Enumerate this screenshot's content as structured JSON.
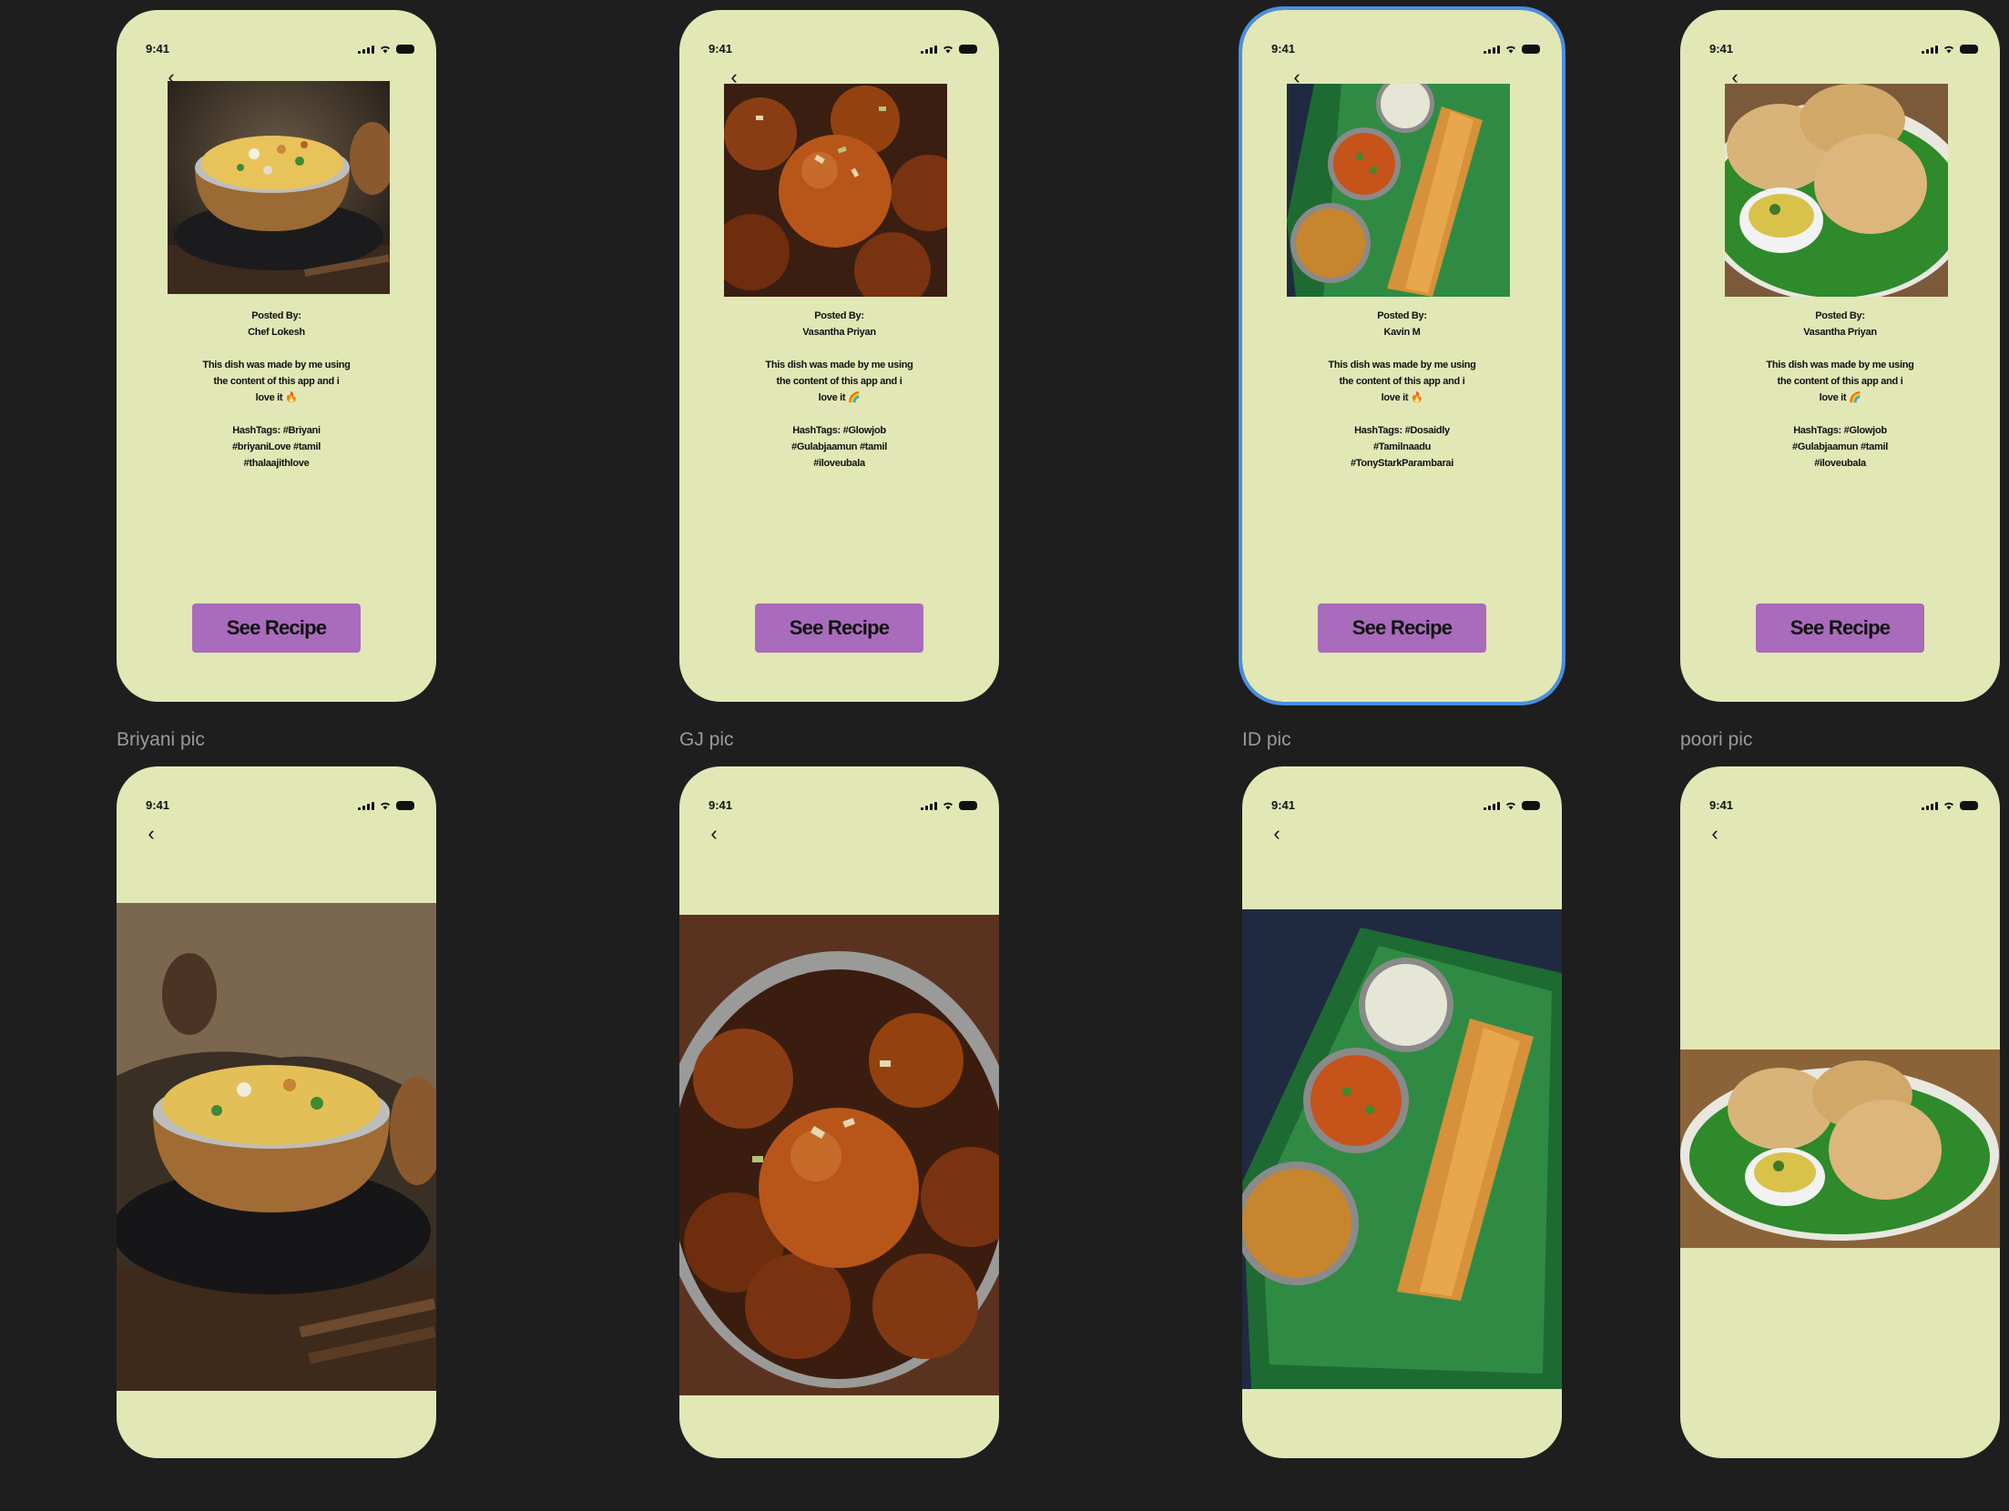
{
  "status_time": "9:41",
  "details_frames": [
    {
      "posted_label": "Posted By:",
      "author": "Chef Lokesh",
      "desc1": "This dish was made by me using",
      "desc2": "the content of this app and i",
      "desc3": "love it 🔥",
      "tags1": "HashTags: #Briyani",
      "tags2": "#briyaniLove #tamil",
      "tags3": "#thalaajithlove",
      "button": "See Recipe"
    },
    {
      "posted_label": "Posted By:",
      "author": "Vasantha Priyan",
      "desc1": "This dish was made by me using",
      "desc2": "the content of this app and i",
      "desc3": "love it 🌈",
      "tags1": "HashTags: #Glowjob",
      "tags2": "#Gulabjaamun #tamil",
      "tags3": "#iloveubala",
      "button": "See Recipe"
    },
    {
      "posted_label": "Posted By:",
      "author": "Kavin M",
      "desc1": "This dish was made by me using",
      "desc2": "the content of this app and i",
      "desc3": "love it 🔥",
      "tags1": "HashTags: #Dosaidly",
      "tags2": "#Tamilnaadu",
      "tags3": "#TonyStarkParambarai",
      "button": "See Recipe"
    },
    {
      "posted_label": "Posted By:",
      "author": "Vasantha Priyan",
      "desc1": "This dish was made by me using",
      "desc2": "the content of this app and i",
      "desc3": "love it 🌈",
      "tags1": "HashTags: #Glowjob",
      "tags2": "#Gulabjaamun #tamil",
      "tags3": "#iloveubala",
      "button": "See Recipe"
    }
  ],
  "frame_labels": [
    "Briyani pic",
    "GJ pic",
    "ID pic",
    "poori pic"
  ],
  "colors": {
    "canvas": "#1e1e1e",
    "frame": "#e1e7b5",
    "button": "#a96bbc",
    "selection": "#4a8fe0"
  }
}
